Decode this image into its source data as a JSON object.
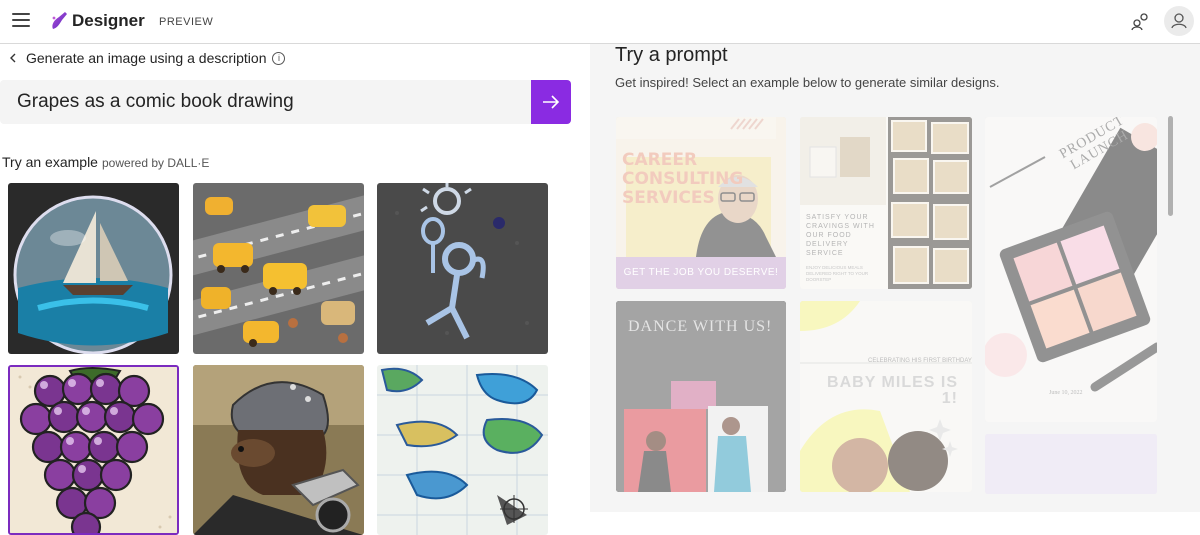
{
  "topbar": {
    "brand": "Designer",
    "badge": "PREVIEW",
    "accent": "#8a2be2"
  },
  "left": {
    "back_label": "Generate an image using a description",
    "info_glyph": "i",
    "prompt_value": "Grapes as a comic book drawing",
    "submit_icon": "arrow-right-icon",
    "try_example": "Try an example",
    "powered_by": "powered by DALL·E",
    "examples": [
      {
        "name": "sailboat-in-glass-sphere"
      },
      {
        "name": "felt-cars-on-roads"
      },
      {
        "name": "chalk-drawing-figure"
      },
      {
        "name": "grapes-comic",
        "selected": true
      },
      {
        "name": "bear-on-motorcycle"
      },
      {
        "name": "watercolor-map"
      }
    ]
  },
  "right": {
    "title": "Try a prompt",
    "subtitle": "Get inspired! Select an example below to generate similar designs.",
    "cards": {
      "career_title": "CAREER CONSULTING SERVICES",
      "career_button": "GET THE JOB YOU DESERVE!",
      "food_title": "SATISFY YOUR CRAVINGS WITH OUR FOOD DELIVERY SERVICE",
      "food_sub": "ENJOY DELICIOUS MEALS DELIVERED RIGHT TO YOUR DOORSTEP",
      "product_title": "PRODUCT LAUNCH",
      "product_date": "June 10, 2022",
      "dance_title": "DANCE WITH US!",
      "baby_celebrating": "CELEBRATING HIS FIRST BIRTHDAY",
      "baby_title": "BABY MILES IS 1!"
    }
  }
}
